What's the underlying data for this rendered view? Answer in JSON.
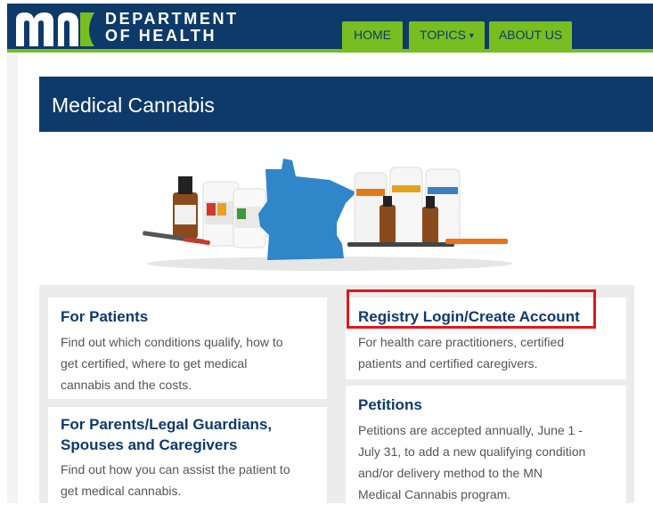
{
  "header": {
    "logo_text": "mn",
    "dept_line1": "DEPARTMENT",
    "dept_line2": "OF HEALTH",
    "nav": [
      {
        "label": "HOME"
      },
      {
        "label": "TOPICS",
        "caret": "▾"
      },
      {
        "label": "ABOUT US"
      }
    ]
  },
  "page": {
    "title": "Medical Cannabis"
  },
  "cards": {
    "patients": {
      "title": "For Patients",
      "lines": [
        "Find out which conditions qualify, how to",
        "get certified, where to get medical",
        "cannabis and the costs."
      ]
    },
    "parents": {
      "title_lines": [
        "For Parents/Legal Guardians,",
        "Spouses and Caregivers"
      ],
      "lines": [
        "Find out how you can assist the patient to",
        "get medical cannabis."
      ]
    },
    "registry": {
      "title": "Registry Login/Create Account",
      "lines": [
        "For health care practitioners, certified",
        "patients and certified caregivers."
      ]
    },
    "petitions": {
      "title": "Petitions",
      "lines": [
        "Petitions are accepted annually, June 1 -",
        "July 31, to add a new qualifying condition",
        "and/or delivery method to the MN",
        "Medical Cannabis program."
      ]
    }
  },
  "colors": {
    "navy": "#0e3a6a",
    "green": "#78be21",
    "highlight": "#e0161b",
    "state_blue": "#2f86c8"
  }
}
